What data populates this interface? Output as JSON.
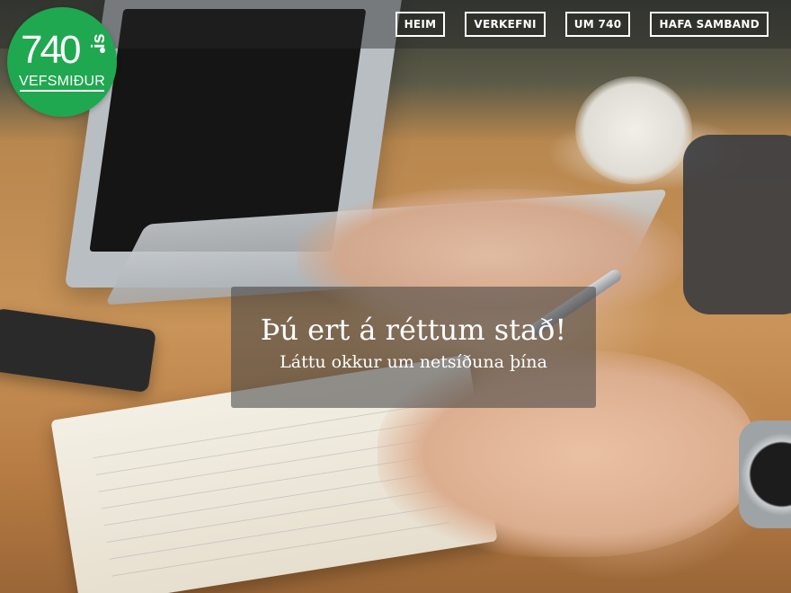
{
  "brand": {
    "logo_number": "740",
    "logo_suffix": "is",
    "logo_subtitle": "VEFSMIÐUR",
    "logo_color": "#1fa84f"
  },
  "nav": {
    "items": [
      {
        "label": "HEIM"
      },
      {
        "label": "VERKEFNI"
      },
      {
        "label": "UM 740"
      },
      {
        "label": "HAFA SAMBAND"
      }
    ]
  },
  "hero": {
    "headline": "Þú ert á réttum stað!",
    "subheadline": "Láttu okkur um netsíðuna þína"
  }
}
